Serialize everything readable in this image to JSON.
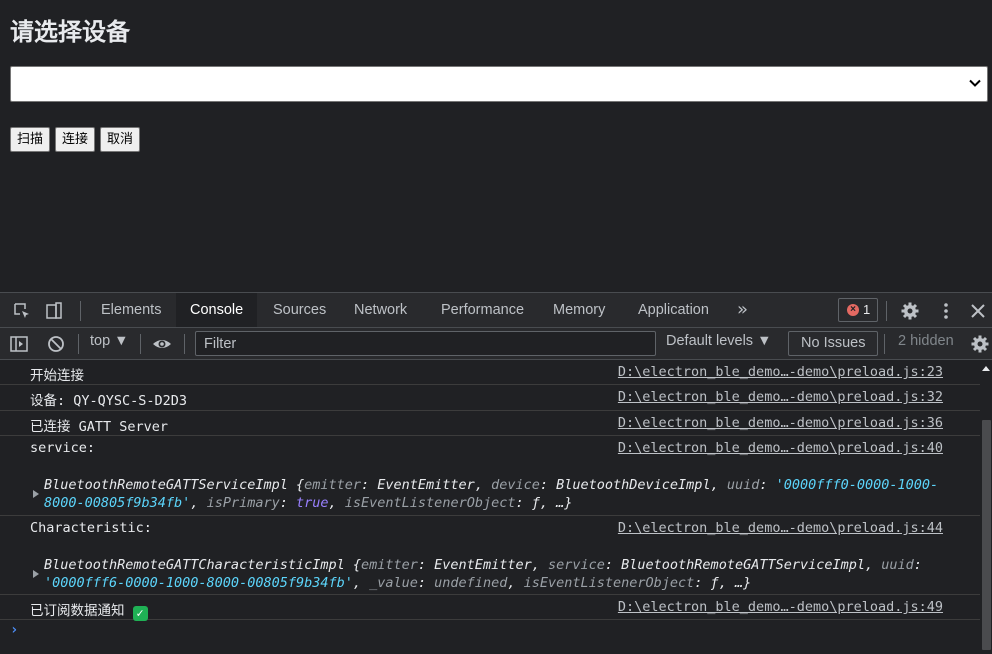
{
  "page": {
    "title": "请选择设备",
    "device_select_value": "",
    "buttons": {
      "scan": "扫描",
      "connect": "连接",
      "cancel": "取消"
    }
  },
  "devtools": {
    "tabs": [
      "Elements",
      "Console",
      "Sources",
      "Network",
      "Performance",
      "Memory",
      "Application"
    ],
    "active_tab": "Console",
    "more_tabs": "»",
    "error_count": "1",
    "toolbar": {
      "context": "top ▼",
      "filter_placeholder": "Filter",
      "levels": "Default levels ▼",
      "issues": "No Issues",
      "hidden": "2 hidden"
    },
    "messages": [
      {
        "text": "开始连接",
        "source": "D:\\electron_ble_demo…-demo\\preload.js:23"
      },
      {
        "text": "设备: QY-QYSC-S-D2D3",
        "source": "D:\\electron_ble_demo…-demo\\preload.js:32"
      },
      {
        "text": "已连接 GATT Server",
        "source": "D:\\electron_ble_demo…-demo\\preload.js:36"
      },
      {
        "text": "service:",
        "source": "D:\\electron_ble_demo…-demo\\preload.js:40",
        "object": {
          "class": "BluetoothRemoteGATTServiceImpl",
          "emitter": "EventEmitter",
          "device": "BluetoothDeviceImpl",
          "uuid_part1": "'0000fff0-0000-1000-",
          "uuid_part2": "8000-00805f9b34fb'",
          "isPrimary": "true",
          "isEventListenerObject": "ƒ"
        }
      },
      {
        "text": "Characteristic:",
        "source": "D:\\electron_ble_demo…-demo\\preload.js:44",
        "object": {
          "class": "BluetoothRemoteGATTCharacteristicImpl",
          "emitter": "EventEmitter",
          "service": "BluetoothRemoteGATTServiceImpl",
          "uuid": "'0000fff6-0000-1000-8000-00805f9b34fb'",
          "_value": "undefined",
          "isEventListenerObject": "ƒ"
        }
      },
      {
        "text": "已订阅数据通知",
        "source": "D:\\electron_ble_demo…-demo\\preload.js:49",
        "emoji": "✓"
      }
    ],
    "prompt": "›"
  }
}
